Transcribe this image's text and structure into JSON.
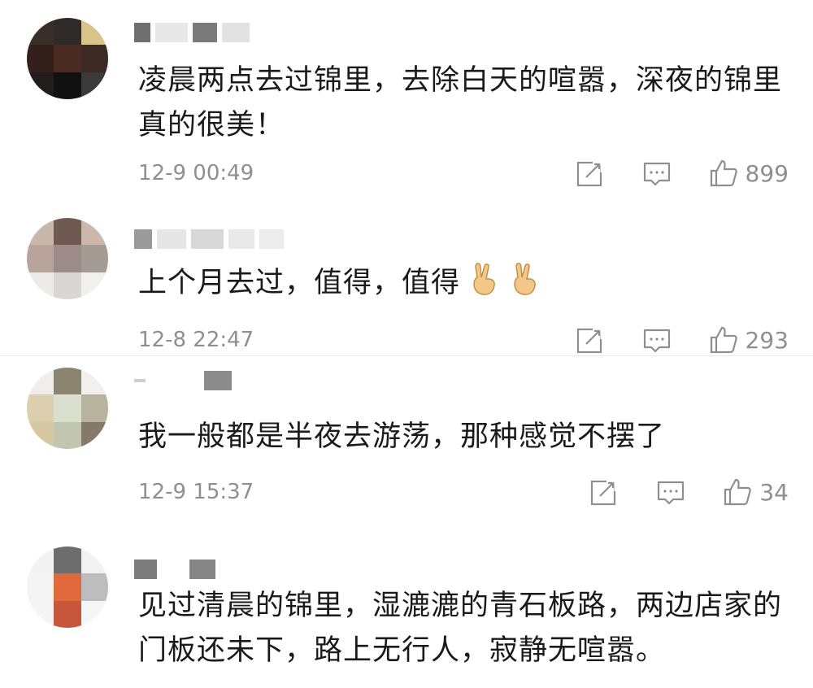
{
  "comments": [
    {
      "text": "凌晨两点去过锦里，去除白天的喧嚣，深夜的锦里真的很美！",
      "time": "12-9 00:49",
      "likes": "899",
      "icons": [
        "share-icon",
        "comment-icon",
        "like-icon"
      ]
    },
    {
      "text": "上个月去过，值得，值得",
      "emoji": [
        "victory-hand-emoji",
        "victory-hand-emoji"
      ],
      "time": "12-8 22:47",
      "likes": "293",
      "icons": [
        "share-icon",
        "comment-icon",
        "like-icon"
      ]
    },
    {
      "text": "我一般都是半夜去游荡，那种感觉不摆了",
      "time": "12-9 15:37",
      "likes": "34",
      "icons": [
        "share-icon",
        "comment-icon",
        "like-icon"
      ]
    },
    {
      "text": "见过清晨的锦里，湿漉漉的青石板路，两边店家的门板还未下，路上无行人，寂静无喧嚣。"
    }
  ],
  "colors": {
    "text": "#1a1a1a",
    "meta": "#8f8f8f",
    "divider": "#e9e9e9"
  }
}
